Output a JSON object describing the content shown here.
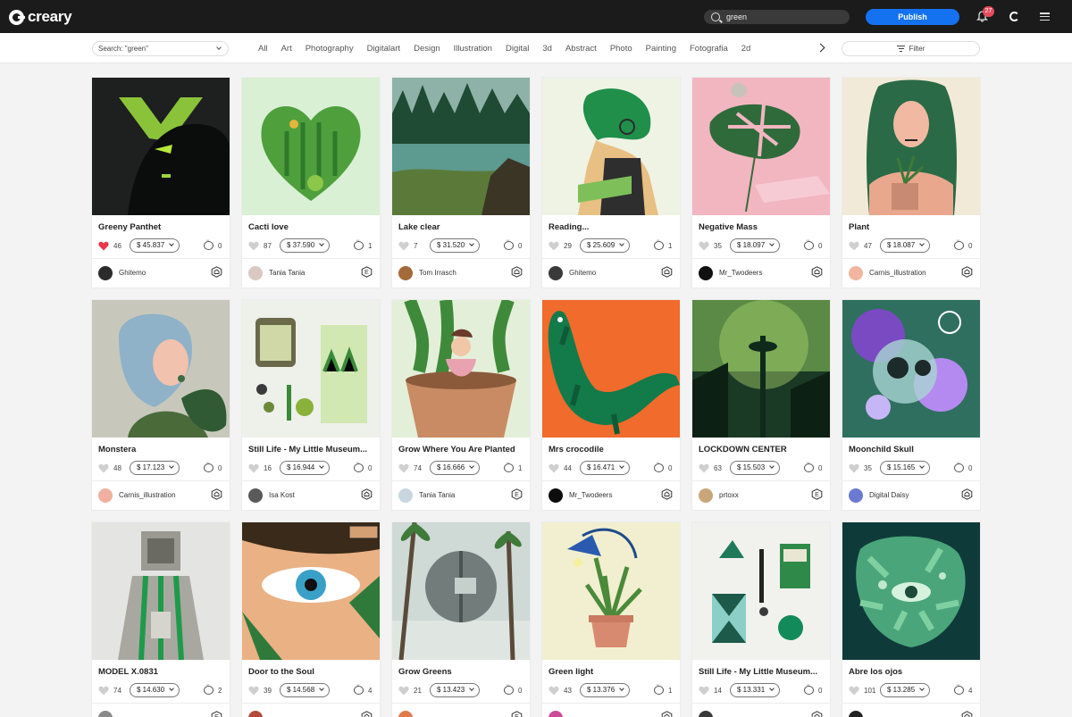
{
  "app": {
    "logo_text": "creary"
  },
  "topbar": {
    "search_value": "green",
    "publish_label": "Publish",
    "notifications_count": "27"
  },
  "filterbar": {
    "query_label": "Search: \"green\"",
    "filter_label": "Filter",
    "categories": [
      "All",
      "Art",
      "Photography",
      "Digitalart",
      "Design",
      "Illustration",
      "Digital",
      "3d",
      "Abstract",
      "Photo",
      "Painting",
      "Fotografia",
      "2d"
    ]
  },
  "colors": {
    "accent": "#1472f0",
    "topbar": "#1b1b1b",
    "liked": "#e8374a",
    "badge": "#e64b5a"
  },
  "cards": [
    {
      "title": "Greeny Panthet",
      "likes": "46",
      "liked": true,
      "price": "$ 45.837",
      "comments": "0",
      "author": "Ghitemo",
      "badge": "house-icon",
      "img": "panther"
    },
    {
      "title": "Cacti love",
      "likes": "87",
      "liked": false,
      "price": "$ 37.590",
      "comments": "1",
      "author": "Tania Tania",
      "badge": "e-icon",
      "img": "cacti"
    },
    {
      "title": "Lake clear",
      "likes": "7",
      "liked": false,
      "price": "$ 31.520",
      "comments": "0",
      "author": "Tom Irrasch",
      "badge": "house-icon",
      "img": "lake"
    },
    {
      "title": "Reading...",
      "likes": "29",
      "liked": false,
      "price": "$ 25.609",
      "comments": "1",
      "author": "Ghitemo",
      "badge": "house-icon",
      "img": "reading"
    },
    {
      "title": "Negative Mass",
      "likes": "35",
      "liked": false,
      "price": "$ 18.097",
      "comments": "0",
      "author": "Mr_Twodeers",
      "badge": "house-icon",
      "img": "mass"
    },
    {
      "title": "Plant",
      "likes": "47",
      "liked": false,
      "price": "$ 18.087",
      "comments": "0",
      "author": "Carnis_illustration",
      "badge": "house-icon",
      "img": "plant"
    },
    {
      "title": "Monstera",
      "likes": "48",
      "liked": false,
      "price": "$ 17.123",
      "comments": "0",
      "author": "Carnis_illustration",
      "badge": "house-icon",
      "img": "monstera"
    },
    {
      "title": "Still Life - My Little Museum...",
      "likes": "16",
      "liked": false,
      "price": "$ 16.944",
      "comments": "0",
      "author": "Isa Kost",
      "badge": "house-icon",
      "img": "stilllife"
    },
    {
      "title": "Grow Where You Are Planted",
      "likes": "74",
      "liked": false,
      "price": "$ 16.666",
      "comments": "1",
      "author": "Tania Tania",
      "badge": "e-icon",
      "img": "grow"
    },
    {
      "title": "Mrs crocodile",
      "likes": "44",
      "liked": false,
      "price": "$ 16.471",
      "comments": "0",
      "author": "Mr_Twodeers",
      "badge": "house-icon",
      "img": "croc"
    },
    {
      "title": "LOCKDOWN CENTER",
      "likes": "63",
      "liked": false,
      "price": "$ 15.503",
      "comments": "0",
      "author": "prtoxx",
      "badge": "e-icon",
      "img": "lockdown"
    },
    {
      "title": "Moonchild Skull",
      "likes": "35",
      "liked": false,
      "price": "$ 15.165",
      "comments": "0",
      "author": "Digital Daisy",
      "badge": "house-icon",
      "img": "skull"
    },
    {
      "title": "MODEL X.0831",
      "likes": "74",
      "liked": false,
      "price": "$ 14.630",
      "comments": "2",
      "author": "",
      "badge": "e-icon",
      "img": "model"
    },
    {
      "title": "Door to the Soul",
      "likes": "39",
      "liked": false,
      "price": "$ 14.568",
      "comments": "4",
      "author": "",
      "badge": "house-icon",
      "img": "eye"
    },
    {
      "title": "Grow Greens",
      "likes": "21",
      "liked": false,
      "price": "$ 13.423",
      "comments": "0",
      "author": "",
      "badge": "e-icon",
      "img": "greens"
    },
    {
      "title": "Green light",
      "likes": "43",
      "liked": false,
      "price": "$ 13.376",
      "comments": "1",
      "author": "",
      "badge": "house-icon",
      "img": "lamp"
    },
    {
      "title": "Still Life - My Little Museum...",
      "likes": "14",
      "liked": false,
      "price": "$ 13.331",
      "comments": "0",
      "author": "",
      "badge": "house-icon",
      "img": "stilllife2"
    },
    {
      "title": "Abre los ojos",
      "likes": "101",
      "liked": false,
      "price": "$ 13.285",
      "comments": "4",
      "author": "",
      "badge": "house-icon",
      "img": "ojos"
    }
  ]
}
